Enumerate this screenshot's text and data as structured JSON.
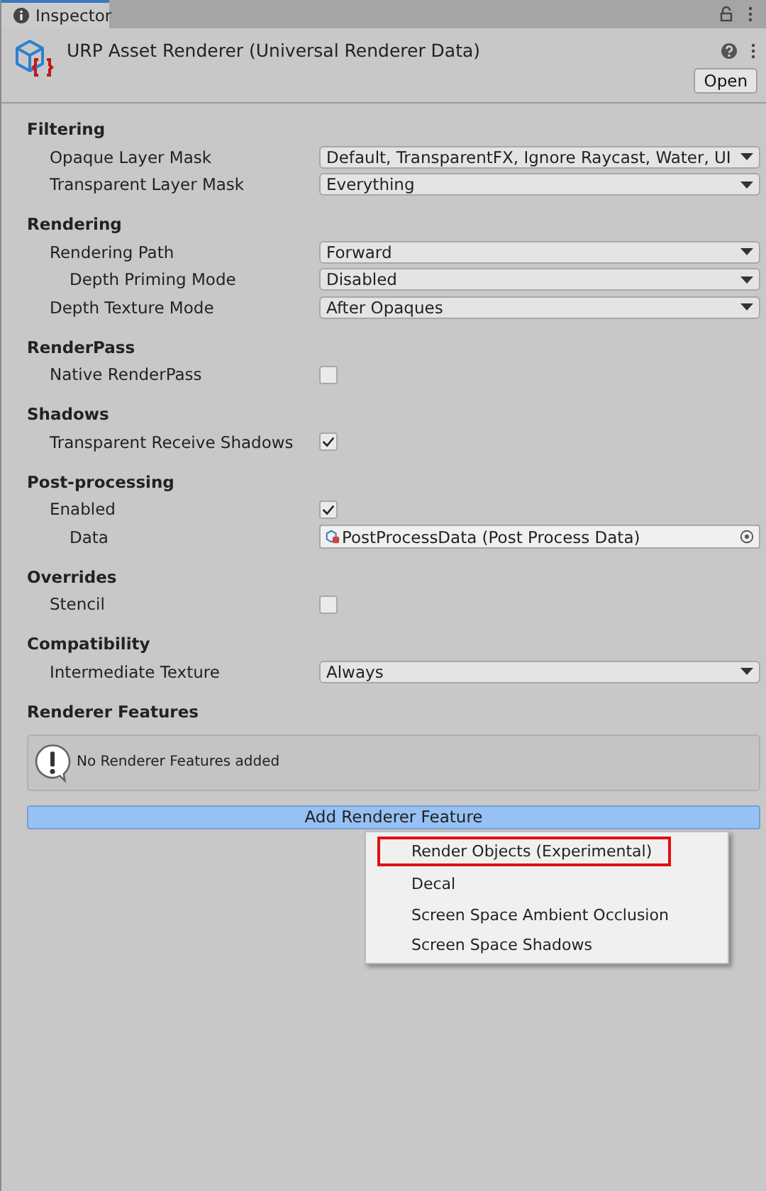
{
  "tab": {
    "label": "Inspector",
    "selected": true
  },
  "header": {
    "title": "URP Asset Renderer (Universal Renderer Data)",
    "open_button": "Open"
  },
  "sections": [
    {
      "title": "Filtering",
      "rows": [
        {
          "kind": "dropdown",
          "label": "Opaque Layer Mask",
          "value": "Default, TransparentFX, Ignore Raycast, Water, UI"
        },
        {
          "kind": "dropdown",
          "label": "Transparent Layer Mask",
          "value": "Everything"
        }
      ]
    },
    {
      "title": "Rendering",
      "rows": [
        {
          "kind": "dropdown",
          "label": "Rendering Path",
          "value": "Forward",
          "children": [
            {
              "kind": "dropdown",
              "label": "Depth Priming Mode",
              "value": "Disabled"
            }
          ]
        },
        {
          "kind": "dropdown",
          "label": "Depth Texture Mode",
          "value": "After Opaques"
        }
      ]
    },
    {
      "title": "RenderPass",
      "rows": [
        {
          "kind": "checkbox",
          "label": "Native RenderPass",
          "checked": false
        }
      ]
    },
    {
      "title": "Shadows",
      "rows": [
        {
          "kind": "checkbox",
          "label": "Transparent Receive Shadows",
          "checked": true
        }
      ]
    },
    {
      "title": "Post-processing",
      "rows": [
        {
          "kind": "checkbox",
          "label": "Enabled",
          "checked": true,
          "children": [
            {
              "kind": "object",
              "label": "Data",
              "value": "PostProcessData (Post Process Data)"
            }
          ]
        }
      ]
    },
    {
      "title": "Overrides",
      "rows": [
        {
          "kind": "checkbox",
          "label": "Stencil",
          "checked": false
        }
      ]
    },
    {
      "title": "Compatibility",
      "rows": [
        {
          "kind": "dropdown",
          "label": "Intermediate Texture",
          "value": "Always"
        }
      ]
    }
  ],
  "renderer_features": {
    "title": "Renderer Features",
    "message": "No Renderer Features added",
    "add_button": "Add Renderer Feature"
  },
  "menu": {
    "items": [
      {
        "label": "Render Objects (Experimental)",
        "selected": true
      },
      {
        "label": "Decal",
        "selected": false
      },
      {
        "label": "Screen Space Ambient Occlusion",
        "selected": false
      },
      {
        "label": "Screen Space Shadows",
        "selected": false
      }
    ]
  }
}
